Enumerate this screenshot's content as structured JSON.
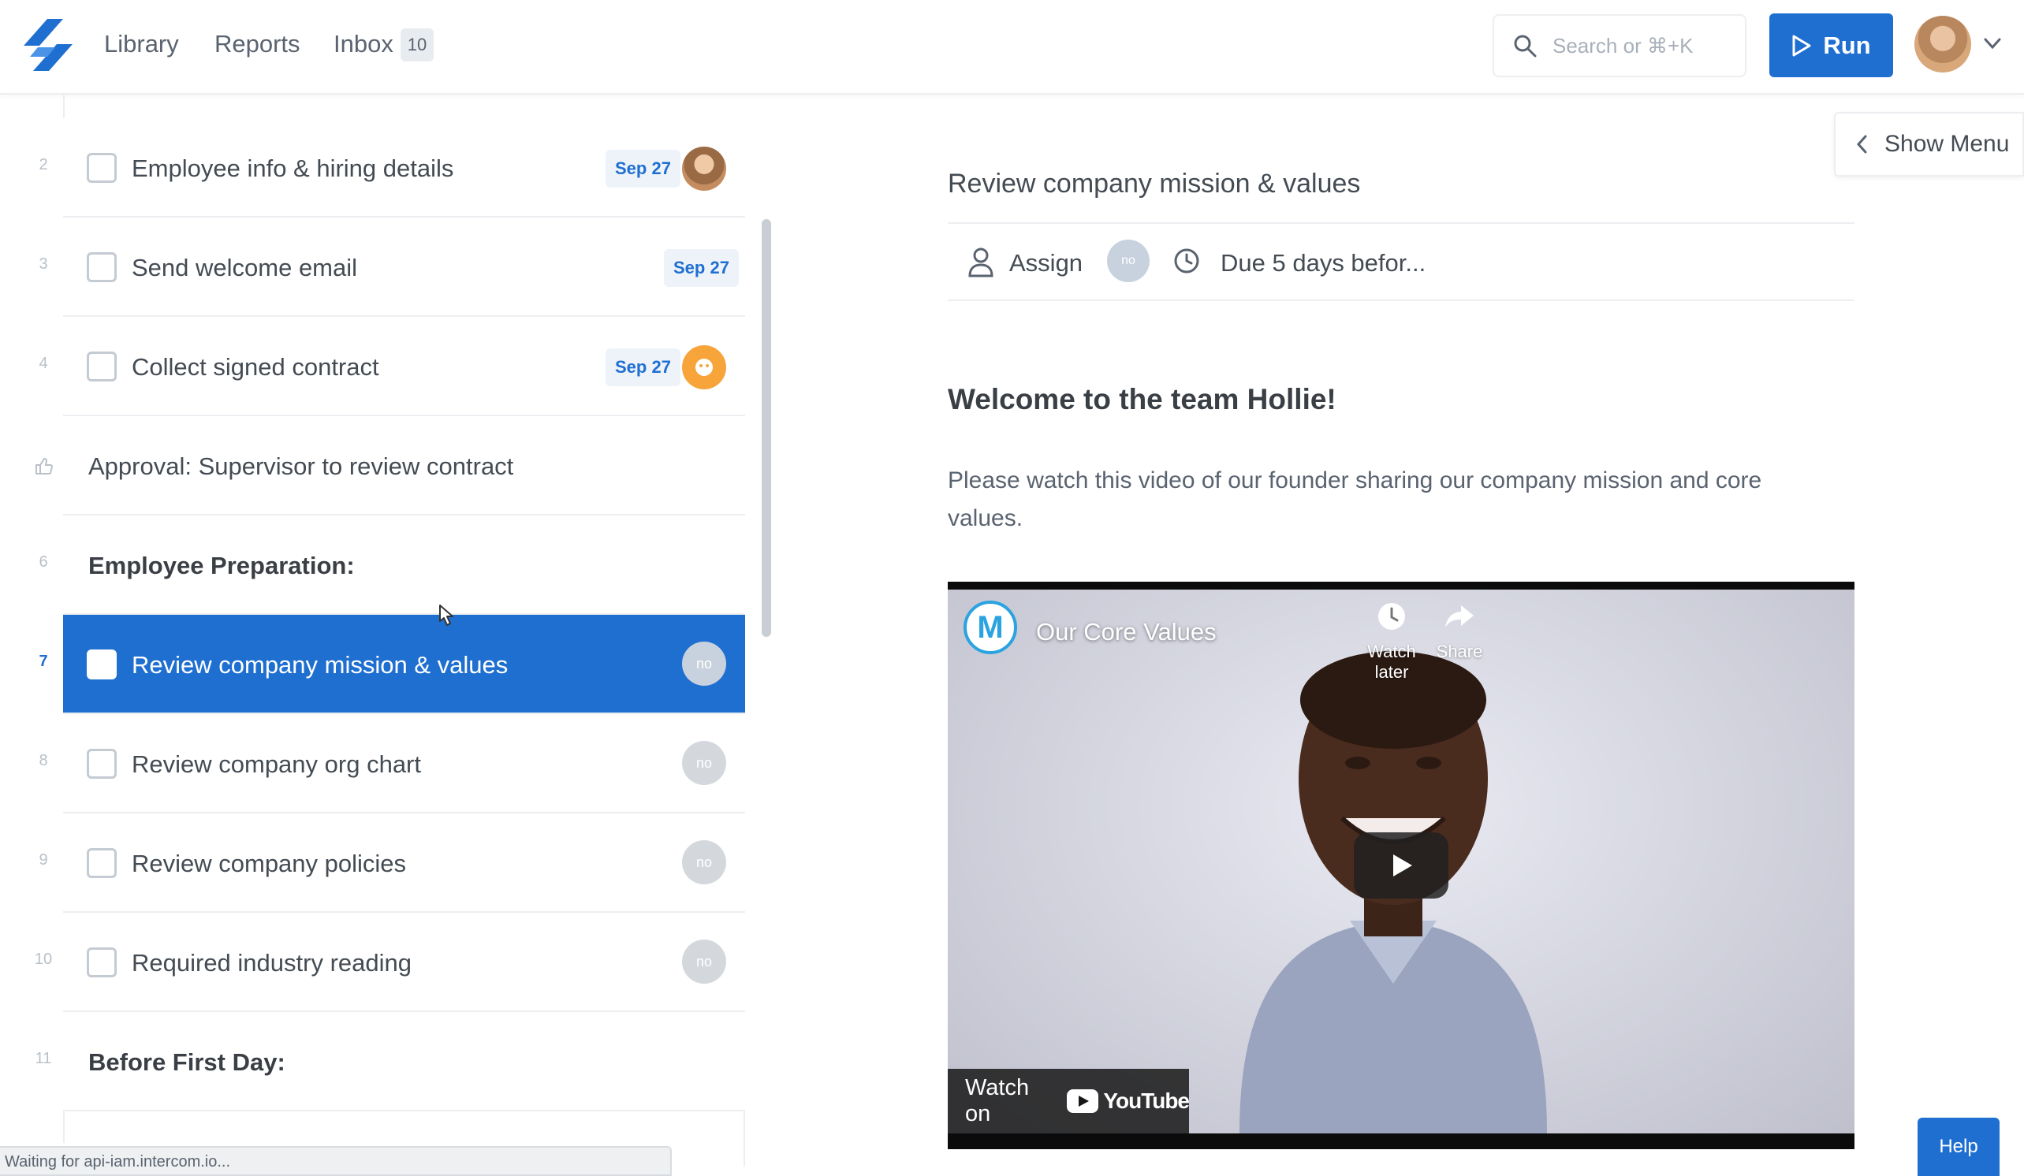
{
  "nav": {
    "library": "Library",
    "reports": "Reports",
    "inbox": "Inbox",
    "inbox_count": "10"
  },
  "search": {
    "placeholder": "Search or ⌘+K"
  },
  "run_button": "Run",
  "checklist": [
    {
      "num": "2",
      "label": "Employee info & hiring details",
      "date": "Sep 27",
      "assignee": "photo"
    },
    {
      "num": "3",
      "label": "Send welcome email",
      "date": "Sep 27"
    },
    {
      "num": "4",
      "label": "Collect signed contract",
      "date": "Sep 27",
      "assignee": "orange"
    },
    {
      "num": "",
      "label": "Approval: Supervisor to review contract"
    },
    {
      "num": "6",
      "label": "Employee Preparation:"
    },
    {
      "num": "7",
      "label": "Review company mission & values",
      "assignee_initials": "no",
      "selected": true
    },
    {
      "num": "8",
      "label": "Review company org chart",
      "assignee_initials": "no"
    },
    {
      "num": "9",
      "label": "Review company policies",
      "assignee_initials": "no"
    },
    {
      "num": "10",
      "label": "Required industry reading",
      "assignee_initials": "no"
    },
    {
      "num": "11",
      "label": "Before First Day:"
    }
  ],
  "detail": {
    "show_menu": "Show Menu",
    "title": "Review company mission & values",
    "assign": "Assign",
    "assignee_initials": "no",
    "due": "Due 5 days befor...",
    "welcome": "Welcome to the team Hollie!",
    "description": "Please watch this video of our founder sharing our company mission and core values."
  },
  "video": {
    "channel_letter": "M",
    "title": "Our Core Values",
    "watch_later": "Watch later",
    "share": "Share",
    "watch_on": "Watch on",
    "youtube": "YouTube"
  },
  "status_text": "Waiting for api-iam.intercom.io...",
  "help": "Help",
  "colors": {
    "primary": "#1f6fd1",
    "date_badge_bg": "#eef3fa"
  }
}
